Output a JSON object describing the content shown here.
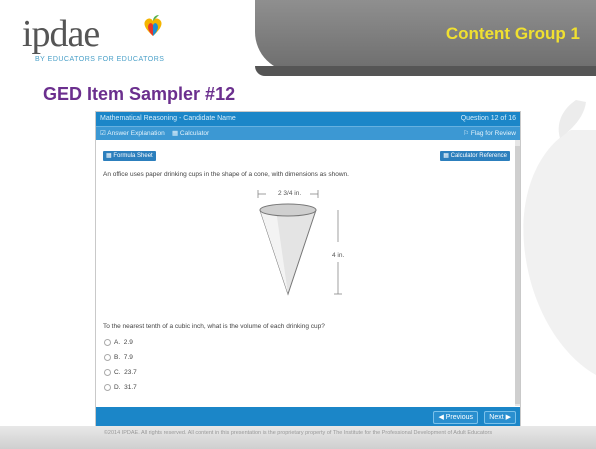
{
  "header": {
    "logo_text": "ipdae",
    "logo_tagline": "BY EDUCATORS FOR EDUCATORS",
    "section_title": "Content Group 1"
  },
  "slide": {
    "title": "GED Item Sampler #12"
  },
  "ged_window": {
    "title": "Mathematical Reasoning - Candidate Name",
    "question_counter": "Question 12 of 16",
    "tools": {
      "answer_explanation": "Answer Explanation",
      "calculator": "Calculator",
      "flag_for_review": "Flag for Review"
    },
    "formula_sheet": "Formula Sheet",
    "calculator_reference": "Calculator Reference",
    "question_text": "An office uses paper drinking cups in the shape of a cone, with dimensions as shown.",
    "diagram": {
      "top_label": "2 3/4 in.",
      "side_label": "4 in."
    },
    "prompt": "To the nearest tenth of a cubic inch, what is the volume of each drinking cup?",
    "choices": [
      {
        "letter": "A.",
        "value": "2.9"
      },
      {
        "letter": "B.",
        "value": "7.9"
      },
      {
        "letter": "C.",
        "value": "23.7"
      },
      {
        "letter": "D.",
        "value": "31.7"
      }
    ],
    "nav": {
      "previous": "Previous",
      "next": "Next"
    }
  },
  "footer": {
    "copyright": "©2014 IPDAE. All rights reserved. All content in this presentation is the proprietary property of The Institute for the Professional Development of Adult Educators"
  },
  "colors": {
    "brand_gray": "#6d6d6d",
    "section_yellow": "#f0e030",
    "title_purple": "#6b2f8e",
    "ged_blue": "#1b86c8"
  }
}
